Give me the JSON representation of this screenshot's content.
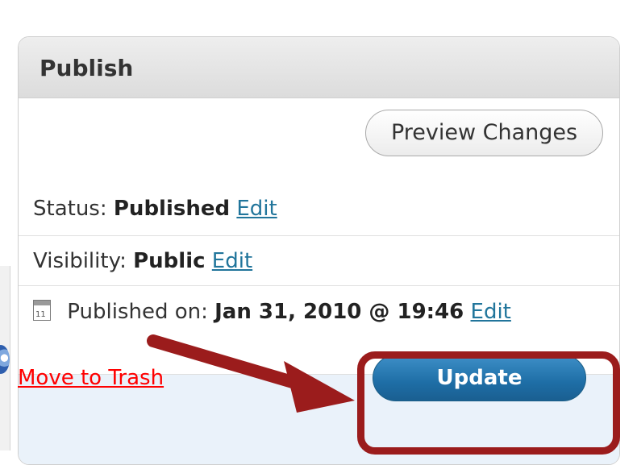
{
  "publish_box": {
    "title": "Publish",
    "preview_button": "Preview Changes",
    "status": {
      "label": "Status:",
      "value": "Published",
      "edit": "Edit"
    },
    "visibility": {
      "label": "Visibility:",
      "value": "Public",
      "edit": "Edit"
    },
    "published_on": {
      "label": "Published on:",
      "value": "Jan 31, 2010 @ 19:46",
      "edit": "Edit",
      "calendar_day": "11"
    },
    "trash_link": "Move to Trash",
    "update_button": "Update"
  },
  "colors": {
    "link": "#21759b",
    "trash": "#ff0000",
    "update_button": "#1e6ea6",
    "annotation": "#9b1c1c"
  },
  "icons": {
    "calendar": "calendar-icon"
  }
}
